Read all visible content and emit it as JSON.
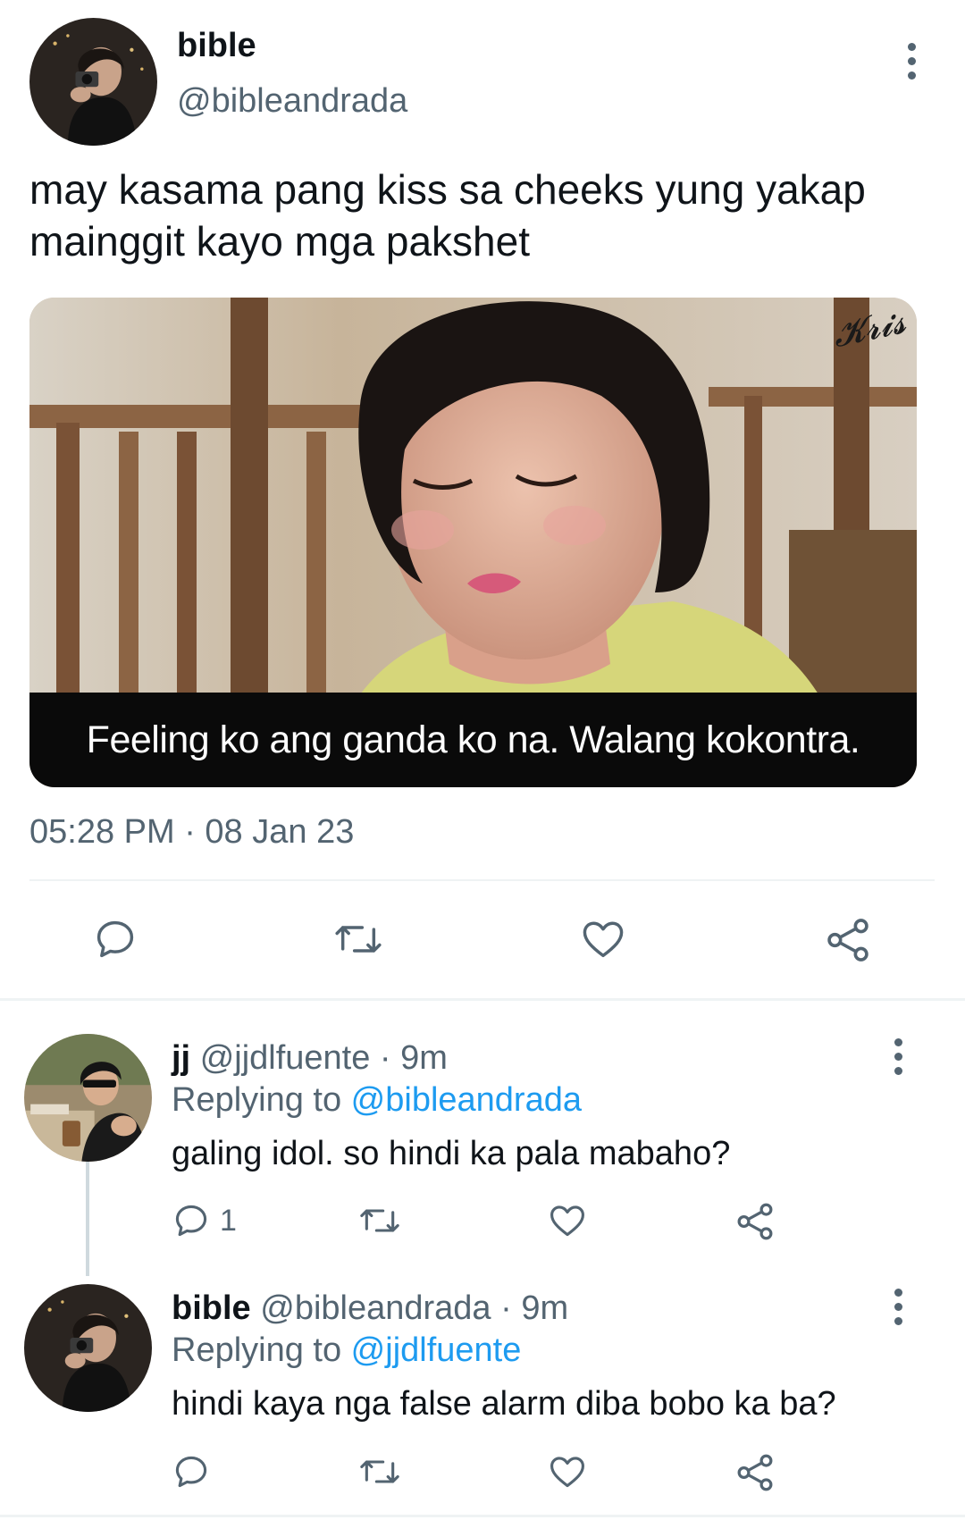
{
  "main_tweet": {
    "name": "bible",
    "handle": "@bibleandrada",
    "text_line1": "may kasama pang kiss sa cheeks yung yakap",
    "text_line2": "mainggit kayo mga pakshet",
    "media": {
      "caption": "Feeling ko ang ganda ko na. Walang kokontra.",
      "signature": "Kris"
    },
    "timestamp": "05:28 PM · 08 Jan 23",
    "actions": [
      "reply-icon",
      "retweet-icon",
      "like-icon",
      "share-icon"
    ]
  },
  "replies": [
    {
      "name": "jj",
      "handle": "@jjdlfuente",
      "sep": " · ",
      "time": "9m",
      "replying_prefix": "Replying to ",
      "replying_to": "@bibleandrada",
      "text": "galing idol. so hindi ka pala mabaho?",
      "reply_count": "1"
    },
    {
      "name": "bible",
      "handle": "@bibleandrada",
      "sep": " · ",
      "time": "9m",
      "replying_prefix": "Replying to ",
      "replying_to": "@jjdlfuente",
      "text": "hindi kaya nga false alarm diba bobo ka ba?"
    }
  ],
  "colors": {
    "text": "#0f1419",
    "secondary": "#536471",
    "link": "#1d9bf0",
    "divider": "#eff3f4"
  }
}
